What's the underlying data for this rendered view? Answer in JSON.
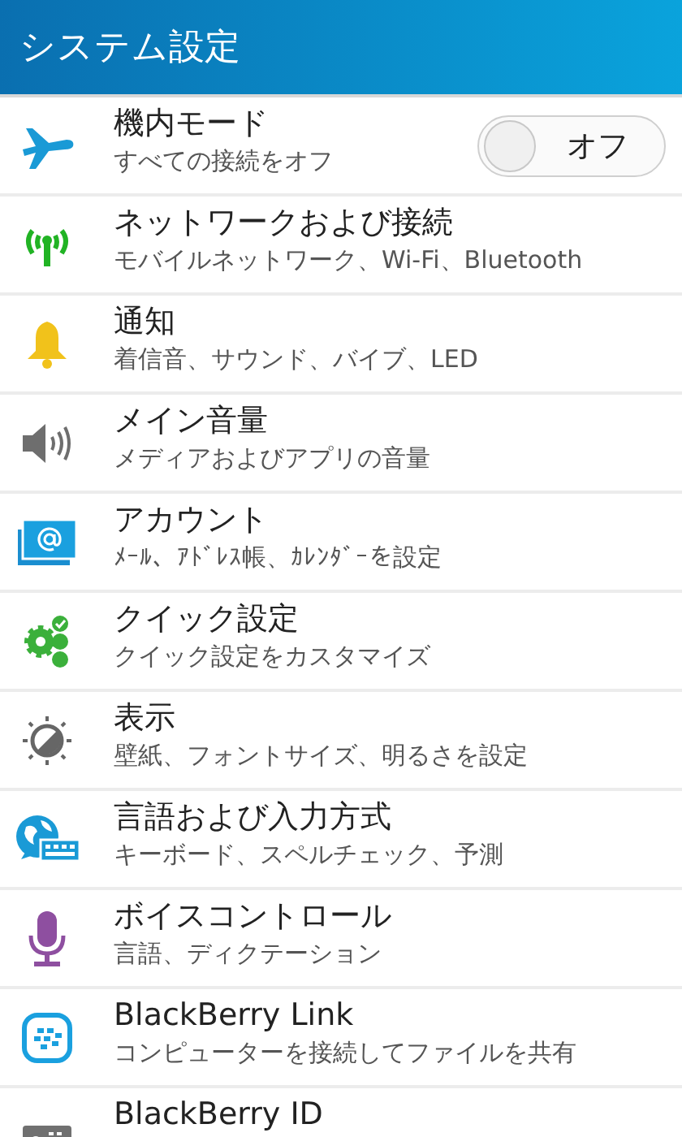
{
  "header": {
    "title": "システム設定"
  },
  "items": [
    {
      "kind": "airplane",
      "title": "機内モード",
      "subtitle": "すべての接続をオフ",
      "toggle": {
        "label": "オフ",
        "on": false
      }
    },
    {
      "kind": "antenna",
      "title": "ネットワークおよび接続",
      "subtitle": "モバイルネットワーク、Wi-Fi、Bluetooth"
    },
    {
      "kind": "bell",
      "title": "通知",
      "subtitle": "着信音、サウンド、バイブ、LED"
    },
    {
      "kind": "speaker",
      "title": "メイン音量",
      "subtitle": "メディアおよびアプリの音量"
    },
    {
      "kind": "account",
      "title": "アカウント",
      "subtitle": "ﾒｰﾙ、ｱﾄﾞﾚｽ帳、ｶﾚﾝﾀﾞｰを設定"
    },
    {
      "kind": "gear",
      "title": "クイック設定",
      "subtitle": "クイック設定をカスタマイズ"
    },
    {
      "kind": "display",
      "title": "表示",
      "subtitle": "壁紙、フォントサイズ、明るさを設定"
    },
    {
      "kind": "language",
      "title": "言語および入力方式",
      "subtitle": "キーボード、スペルチェック、予測"
    },
    {
      "kind": "voice",
      "title": "ボイスコントロール",
      "subtitle": "言語、ディクテーション"
    },
    {
      "kind": "link",
      "title": "BlackBerry Link",
      "subtitle": "コンピューターを接続してファイルを共有"
    },
    {
      "kind": "id",
      "title": "BlackBerry ID"
    }
  ]
}
